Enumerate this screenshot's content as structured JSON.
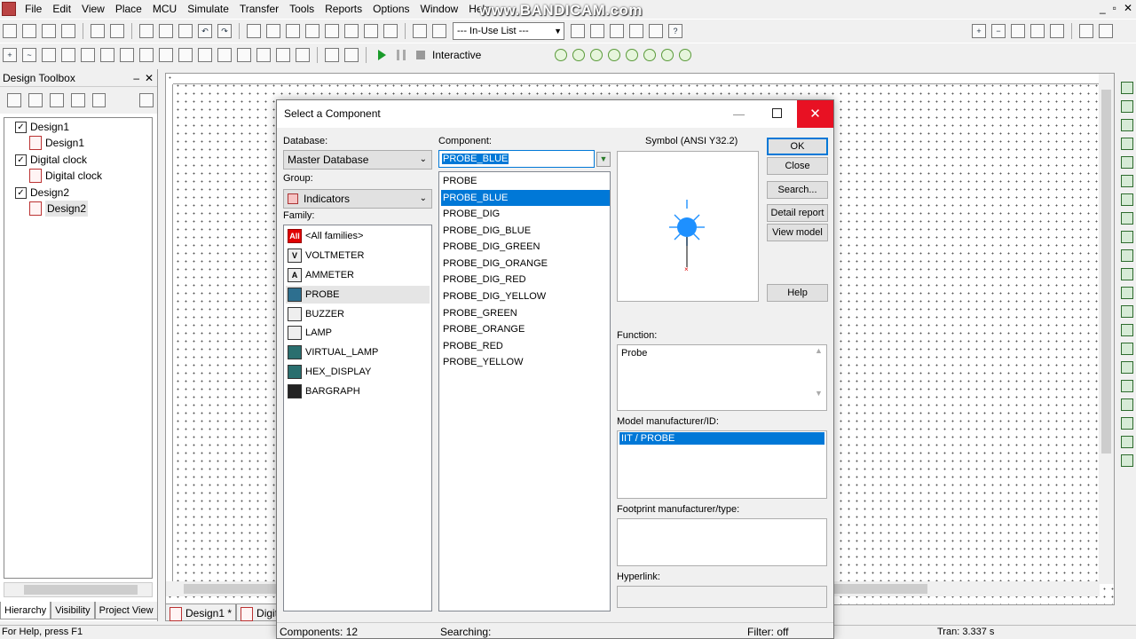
{
  "menu": [
    "File",
    "Edit",
    "View",
    "Place",
    "MCU",
    "Simulate",
    "Transfer",
    "Tools",
    "Reports",
    "Options",
    "Window",
    "Help"
  ],
  "watermark": "www.BANDICAM.com",
  "toolbar": {
    "in_use_list": "--- In-Use List ---",
    "interactive_label": "Interactive"
  },
  "toolbox": {
    "title": "Design Toolbox",
    "tree": [
      {
        "label": "Design1",
        "child": "Design1"
      },
      {
        "label": "Digital clock",
        "child": "Digital clock"
      },
      {
        "label": "Design2",
        "child": "Design2"
      }
    ],
    "tabs": [
      "Hierarchy",
      "Visibility",
      "Project View"
    ]
  },
  "doc_tabs": [
    "Design1 *",
    "Digita"
  ],
  "status": {
    "help": "For Help, press F1",
    "tran": "Tran: 3.337 s"
  },
  "dialog": {
    "title": "Select a Component",
    "database_label": "Database:",
    "database_value": "Master Database",
    "group_label": "Group:",
    "group_value": "Indicators",
    "family_label": "Family:",
    "families": [
      {
        "name": "<All families>",
        "icon": "all-families-icon",
        "icon_text": "All"
      },
      {
        "name": "VOLTMETER",
        "icon": "voltmeter-icon",
        "icon_text": "V"
      },
      {
        "name": "AMMETER",
        "icon": "ammeter-icon",
        "icon_text": "A"
      },
      {
        "name": "PROBE",
        "icon": "probe-icon",
        "icon_text": "",
        "selected": true
      },
      {
        "name": "BUZZER",
        "icon": "buzzer-icon",
        "icon_text": ""
      },
      {
        "name": "LAMP",
        "icon": "lamp-icon",
        "icon_text": ""
      },
      {
        "name": "VIRTUAL_LAMP",
        "icon": "virtual-lamp-icon",
        "icon_text": ""
      },
      {
        "name": "HEX_DISPLAY",
        "icon": "hex-display-icon",
        "icon_text": ""
      },
      {
        "name": "BARGRAPH",
        "icon": "bargraph-icon",
        "icon_text": ""
      }
    ],
    "component_label": "Component:",
    "component_value": "PROBE_BLUE",
    "components": [
      "PROBE",
      "PROBE_BLUE",
      "PROBE_DIG",
      "PROBE_DIG_BLUE",
      "PROBE_DIG_GREEN",
      "PROBE_DIG_ORANGE",
      "PROBE_DIG_RED",
      "PROBE_DIG_YELLOW",
      "PROBE_GREEN",
      "PROBE_ORANGE",
      "PROBE_RED",
      "PROBE_YELLOW"
    ],
    "selected_component": "PROBE_BLUE",
    "symbol_label": "Symbol (ANSI Y32.2)",
    "function_label": "Function:",
    "function_value": "Probe",
    "model_label": "Model manufacturer/ID:",
    "model_value": "IIT / PROBE",
    "footprint_label": "Footprint manufacturer/type:",
    "hyperlink_label": "Hyperlink:",
    "buttons": {
      "ok": "OK",
      "close": "Close",
      "search": "Search...",
      "detail_report": "Detail report",
      "view_model": "View model",
      "help": "Help"
    },
    "status_components": "Components: 12",
    "status_searching": "Searching:",
    "status_filter": "Filter: off"
  },
  "colors": {
    "selection": "#0078d7",
    "close_button": "#e81123",
    "probe_symbol": "#1e90ff"
  }
}
